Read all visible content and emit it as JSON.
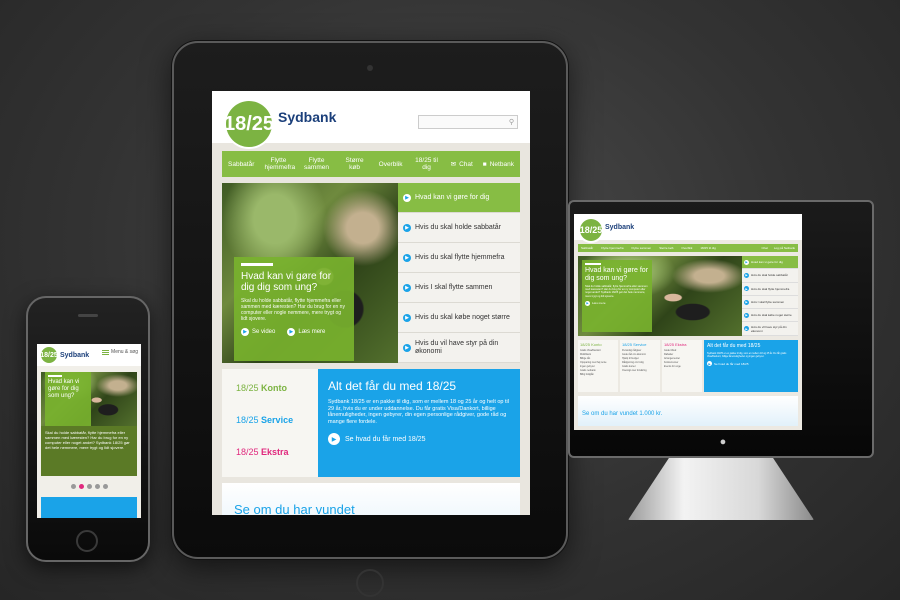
{
  "site": {
    "brand": "Sydbank",
    "logo_text": "18/25",
    "colors": {
      "green": "#87bd44",
      "blue": "#1aa3e8",
      "pink": "#e0287d",
      "navy": "#1b3f7a"
    }
  },
  "tablet": {
    "nav": [
      "Sabbatår",
      "Flytte hjemmefra",
      "Flytte sammen",
      "Større køb",
      "Overblik",
      "18/25 til dig"
    ],
    "chat": "Chat",
    "netbank": "Netbank",
    "hero": {
      "title": "Hvad kan vi gøre for dig dig som ung?",
      "body": "Skal du holde sabbatår, flytte hjemmefra eller sammen med kæresten? Har du brug for en ny computer eller nogle nemmere, mere trygt og lidt sjovere.",
      "video": "Se video",
      "more": "Læs mere"
    },
    "list": [
      "Hvad kan vi gøre for dig",
      "Hvis du skal holde sabbatår",
      "Hvis du skal flytte hjemmefra",
      "Hvis I skal flytte sammen",
      "Hvis du skal købe noget større",
      "Hvis du vil have styr på din økonomi"
    ],
    "cats": [
      {
        "num": "18/25",
        "label": "Konto",
        "color": "#7cb342"
      },
      {
        "num": "18/25",
        "label": "Service",
        "color": "#1aa3e8"
      },
      {
        "num": "18/25",
        "label": "Ekstra",
        "color": "#e0287d"
      }
    ],
    "promo": {
      "title": "Alt det får du med 18/25",
      "body": "Sydbank 18/25 er en pakke til dig, som er mellem 18 og 25 år og helt op til 29 år, hvis du er under uddannelse. Du får gratis Visa/Dankort, billige lånemuligheder, ingen gebyrer, din egen personlige rådgiver, gode råd og mange flere fordele.",
      "cta": "Se hvad du får med 18/25"
    },
    "win": "Se om du har vundet"
  },
  "phone": {
    "menu": "Menu & søg",
    "hero_title": "Hvad kan vi gøre for dig som ung?",
    "body": "Skal du holde sabbatår, flytte hjemmefra eller sammen med kæresten? Har du brug for en ny computer eller noget andet? Sydbank 18/25 gør det hele nemmere, mere trygt og lidt sjovere."
  },
  "desktop": {
    "nav": [
      "Sabbatår",
      "Flytte hjemmefra",
      "Flytte sammen",
      "Større køb",
      "Overblik",
      "18/25 til dig"
    ],
    "chat": "Chat",
    "netbank": "Log på Netbank",
    "hero": {
      "title": "Hvad kan vi gøre for dig som ung?",
      "body": "Skal du holde sabbatår, flytte hjemmefra eller sammen med kæresten? Har du brug for en ny computer eller noget andet? Sydbank 18/25 gør det hele nemmere, mere trygt og lidt sjovere.",
      "more": "Læs mere"
    },
    "list": [
      "Hvad kan vi gøre for dig",
      "Hvis du skal holde sabbatår",
      "Hvis du skal flytte hjemmefra",
      "Hvis I skal flytte sammen",
      "Hvis du skal købe noget større",
      "Hvis du vil have styr på din økonomi"
    ],
    "cols": [
      {
        "head": "18/25 Konto",
        "items": [
          "Gratis Visa/Dankort",
          "Mobilbank",
          "Billige lån",
          "Opsparing med høj rente",
          "Ingen gebyrer",
          "Gratis netbank",
          "Billig boliglån"
        ]
      },
      {
        "head": "18/25 Service",
        "items": [
          "Personlig rådgiver",
          "Gode råd om økonomi",
          "Hjælp til budget",
          "Rådgivning om bolig",
          "Gratis kurser",
          "Oversigt over forsikring"
        ]
      },
      {
        "head": "18/25 Ekstra",
        "items": [
          "Gode tilbud",
          "Rabatter",
          "Arrangementer",
          "Konkurrencer",
          "Events for unge"
        ]
      }
    ],
    "promo": {
      "title": "Alt det får du med 18/25",
      "body": "Sydbank 18/25 er en pakke til dig, som er mellem 18 og 25 år. Du får gratis Visa/Dankort, billige lånemuligheder og ingen gebyrer.",
      "cta": "Se hvad du får med 18/25"
    },
    "win": "Se om du har vundet 1.000 kr."
  }
}
